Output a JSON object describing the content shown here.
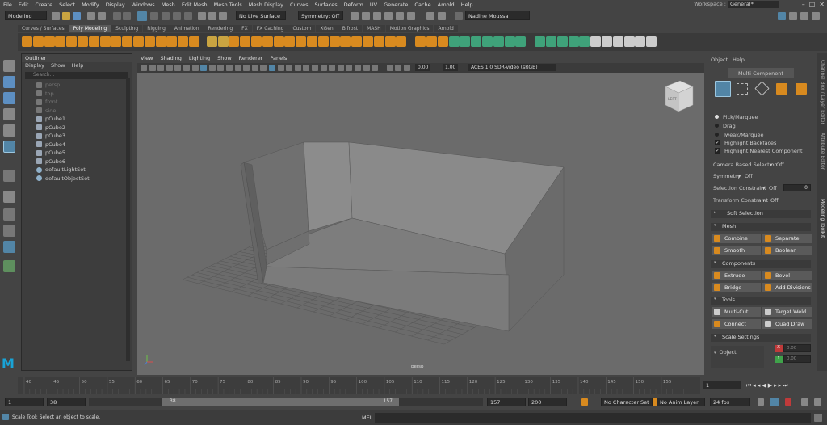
{
  "menubar": {
    "items": [
      "File",
      "Edit",
      "Create",
      "Select",
      "Modify",
      "Display",
      "Windows",
      "Mesh",
      "Edit Mesh",
      "Mesh Tools",
      "Mesh Display",
      "Curves",
      "Surfaces",
      "Deform",
      "UV",
      "Generate",
      "Cache",
      "Arnold",
      "Help"
    ]
  },
  "workspace": {
    "label": "Workspace :",
    "value": "General*"
  },
  "statusline": {
    "mode": "Modeling",
    "live_surface": "No Live Surface",
    "symmetry": "Symmetry: Off",
    "user": "Nadine Moussa"
  },
  "shelf": {
    "tabs": [
      "Curves / Surfaces",
      "Poly Modeling",
      "Sculpting",
      "Rigging",
      "Animation",
      "Rendering",
      "FX",
      "FX Caching",
      "Custom",
      "XGen",
      "Bifrost",
      "MASH",
      "Motion Graphics",
      "Arnold"
    ],
    "active": "Poly Modeling"
  },
  "outliner": {
    "title": "Outliner",
    "menu": [
      "Display",
      "Show",
      "Help"
    ],
    "search_placeholder": "Search...",
    "items": [
      {
        "label": "persp",
        "type": "camera",
        "dim": true
      },
      {
        "label": "top",
        "type": "camera",
        "dim": true
      },
      {
        "label": "front",
        "type": "camera",
        "dim": true
      },
      {
        "label": "side",
        "type": "camera",
        "dim": true
      },
      {
        "label": "pCube1",
        "type": "mesh",
        "dim": false
      },
      {
        "label": "pCube2",
        "type": "mesh",
        "dim": false
      },
      {
        "label": "pCube3",
        "type": "mesh",
        "dim": false
      },
      {
        "label": "pCube4",
        "type": "mesh",
        "dim": false
      },
      {
        "label": "pCube5",
        "type": "mesh",
        "dim": false
      },
      {
        "label": "pCube6",
        "type": "mesh",
        "dim": false
      },
      {
        "label": "defaultLightSet",
        "type": "set",
        "dim": false
      },
      {
        "label": "defaultObjectSet",
        "type": "set",
        "dim": false
      }
    ]
  },
  "viewport": {
    "menu": [
      "View",
      "Shading",
      "Lighting",
      "Show",
      "Renderer",
      "Panels"
    ],
    "near_value": "0.00",
    "gamma_value": "1.00",
    "color_space": "ACES 1.0 SDR-video (sRGB)",
    "camera_label": "persp",
    "viewcube_label": "LEFT"
  },
  "modeling_toolkit": {
    "menu": [
      "Object",
      "Help"
    ],
    "mode_label": "Multi-Component",
    "options": [
      "Pick/Marquee",
      "Drag",
      "Tweak/Marquee"
    ],
    "checks": [
      "Highlight Backfaces",
      "Highlight Nearest Component"
    ],
    "camera_based_selection": {
      "label": "Camera Based Selection",
      "value": "Off"
    },
    "symmetry": {
      "label": "Symmetry",
      "value": "Off"
    },
    "selection_constraint": {
      "label": "Selection Constraint",
      "value": "Off",
      "number": "0"
    },
    "transform_constraint": {
      "label": "Transform Constraint",
      "value": "Off"
    },
    "soft_selection": "Soft Selection",
    "mesh_section": "Mesh",
    "mesh_buttons": [
      "Combine",
      "Separate",
      "Smooth",
      "Boolean"
    ],
    "components_section": "Components",
    "component_buttons": [
      "Extrude",
      "Bevel",
      "Bridge",
      "Add Divisions"
    ],
    "tools_section": "Tools",
    "tool_buttons": [
      "Multi-Cut",
      "Target Weld",
      "Connect",
      "Quad Draw"
    ],
    "scale_settings_section": "Scale Settings",
    "scale_space": "Object",
    "axis_x": "X",
    "axis_y": "Y",
    "axis_value_x": "0.00",
    "axis_value_y": "0.00"
  },
  "side_tabs": [
    "Channel Box / Layer Editor",
    "Attribute Editor",
    "Modeling Toolkit"
  ],
  "timeline": {
    "ticks": [
      "40",
      "45",
      "50",
      "55",
      "60",
      "65",
      "70",
      "75",
      "80",
      "85",
      "90",
      "95",
      "100",
      "105",
      "110",
      "115",
      "120",
      "125",
      "130",
      "135",
      "140",
      "145",
      "150",
      "155"
    ],
    "current_frame": "1"
  },
  "range": {
    "start": "1",
    "range_start": "38",
    "slider_start": "38",
    "slider_end": "157",
    "range_end": "157",
    "end": "200",
    "character_set": "No Character Set",
    "anim_layer": "No Anim Layer",
    "fps": "24 fps"
  },
  "cmdline": {
    "status": "Scale Tool: Select an object to scale.",
    "mel_label": "MEL"
  },
  "colors": {
    "accent": "#d88a1f",
    "highlight": "#5285a6",
    "mesh_green": "#3fa27a"
  }
}
